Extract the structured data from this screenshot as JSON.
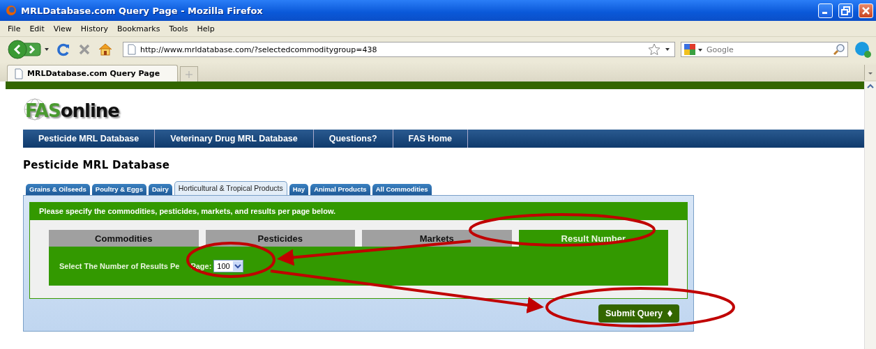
{
  "window": {
    "title": "MRLDatabase.com Query Page - Mozilla Firefox"
  },
  "menu": [
    "File",
    "Edit",
    "View",
    "History",
    "Bookmarks",
    "Tools",
    "Help"
  ],
  "address": {
    "value": "http://www.mrldatabase.com/?selectedcommoditygroup=438"
  },
  "search": {
    "placeholder": "Google"
  },
  "browser_tabs": [
    {
      "label": "MRLDatabase.com Query Page",
      "selected": true
    }
  ],
  "site": {
    "logo": [
      "FAS",
      "online"
    ],
    "nav": [
      "Pesticide MRL Database",
      "Veterinary Drug MRL Database",
      "Questions?",
      "FAS Home"
    ],
    "heading": "Pesticide MRL Database",
    "tabs": [
      {
        "label": "Grains & Oilseeds",
        "selected": false
      },
      {
        "label": "Poultry & Eggs",
        "selected": false
      },
      {
        "label": "Dairy",
        "selected": false
      },
      {
        "label": "Horticultural & Tropical Products",
        "selected": true
      },
      {
        "label": "Hay",
        "selected": false
      },
      {
        "label": "Animal Products",
        "selected": false
      },
      {
        "label": "All Commodities",
        "selected": false
      }
    ],
    "instructions": "Please specify the commodities, pesticides, markets, and results per page below.",
    "sections": [
      {
        "label": "Commodities",
        "selected": false
      },
      {
        "label": "Pesticides",
        "selected": false
      },
      {
        "label": "Markets",
        "selected": false
      },
      {
        "label": "Result Number",
        "selected": true
      }
    ],
    "results_label": "Select The Number of Results Pe",
    "results_label_end": "Page:",
    "results_per_page": "100",
    "submit": "Submit Query"
  }
}
